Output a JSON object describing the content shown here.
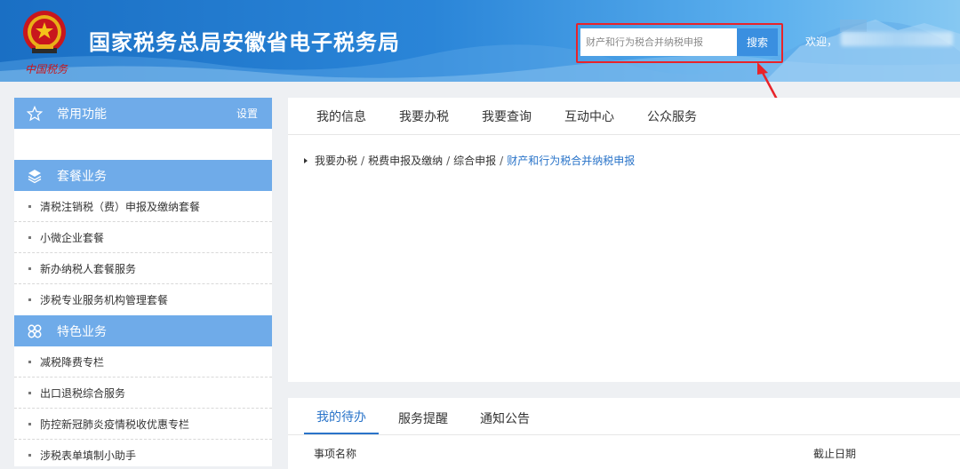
{
  "header": {
    "title": "国家税务总局安徽省电子税务局",
    "emblem_caption": "中国税务",
    "search": {
      "placeholder": "财产和行为税合并纳税申报",
      "button_label": "搜索"
    },
    "welcome": "欢迎，"
  },
  "sidebar": {
    "common": {
      "title": "常用功能",
      "settings_label": "设置"
    },
    "package": {
      "title": "套餐业务",
      "items": [
        "清税注销税（费）申报及缴纳套餐",
        "小微企业套餐",
        "新办纳税人套餐服务",
        "涉税专业服务机构管理套餐"
      ]
    },
    "special": {
      "title": "特色业务",
      "items": [
        "减税降费专栏",
        "出口退税综合服务",
        "防控新冠肺炎疫情税收优惠专栏",
        "涉税表单填制小助手"
      ]
    }
  },
  "main": {
    "tabs": [
      "我的信息",
      "我要办税",
      "我要查询",
      "互动中心",
      "公众服务"
    ],
    "breadcrumb": {
      "items": [
        "我要办税",
        "税费申报及缴纳",
        "综合申报"
      ],
      "current": "财产和行为税合并纳税申报",
      "separator": "/"
    }
  },
  "bottom": {
    "tabs": [
      "我的待办",
      "服务提醒",
      "通知公告"
    ],
    "columns": {
      "name": "事项名称",
      "deadline": "截止日期"
    }
  },
  "colors": {
    "header_start": "#1a6fc4",
    "header_end": "#86c8f2",
    "sidebar_head": "#6fabe9",
    "highlight_red": "#e8232a",
    "link_blue": "#2a74c9"
  }
}
